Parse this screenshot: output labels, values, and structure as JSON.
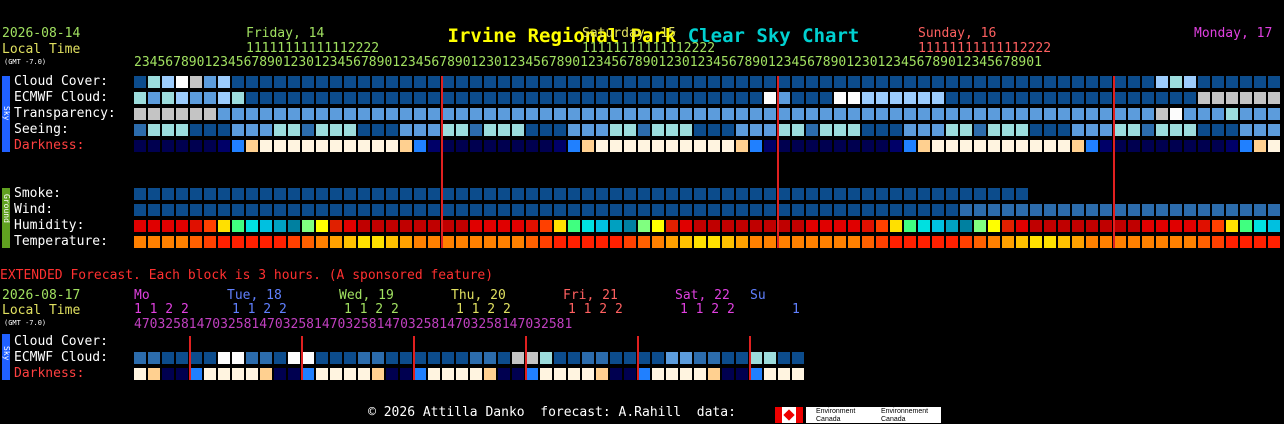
{
  "title": {
    "part1": "Irvine Regional Park",
    "part2": "Clear Sky Chart"
  },
  "colors": {
    "ink_green": "#a0e060",
    "ink_yellow": "#e0e060",
    "ink_label": "#ffffff",
    "ink_darkness": "#ff4040",
    "day1": "#a0e060",
    "day2": "#e0e060",
    "day3": "#ff6060",
    "day4": "#e040e0"
  },
  "main": {
    "date": "2026-08-14",
    "local_time_label": "Local Time",
    "gmt_label": "(GMT -7.0)",
    "days": [
      {
        "label": "Friday, 14"
      },
      {
        "label": "Saturday, 15"
      },
      {
        "label": "Sunday, 16"
      },
      {
        "label": "Monday, 17"
      }
    ],
    "hours_tens": "11111111111112222",
    "hours_ones": "23456789012345678901230123456789012345678901230123456789012345678901230123456789012345678901230123456789012345678901",
    "sky_side_label": "Sky",
    "ground_side_label": "Ground",
    "row_labels": {
      "cloud": "Cloud Cover:",
      "ecmwf": "ECMWF Cloud:",
      "transparency": "Transparency:",
      "seeing": "Seeing:",
      "darkness": "Darkness:",
      "smoke": "Smoke:",
      "wind": "Wind:",
      "humidity": "Humidity:",
      "temperature": "Temperature:"
    }
  },
  "extended": {
    "banner": "EXTENDED Forecast. Each block is 3 hours. (A sponsored feature)",
    "date": "2026-08-17",
    "local_time_label": "Local Time",
    "gmt_label": "(GMT -7.0)",
    "days": [
      "Mo",
      "Tue, 18",
      "Wed, 19",
      "Thu, 20",
      "Fri, 21",
      "Sat, 22",
      "Su"
    ],
    "hours_tens_groups": "1 1 2 2",
    "hours_ones": "47032581470325814703258147032581470325814703258147032581",
    "hours_tail_ten": "1",
    "row_labels": {
      "cloud": "Cloud Cover:",
      "ecmwf": "ECMWF Cloud:",
      "darkness": "Darkness:"
    }
  },
  "footer": {
    "text": "© 2026 Attilla Danko  forecast: A.Rahill  data:",
    "agency_en": "Environment Canada",
    "agency_fr": "Environnement Canada"
  }
}
